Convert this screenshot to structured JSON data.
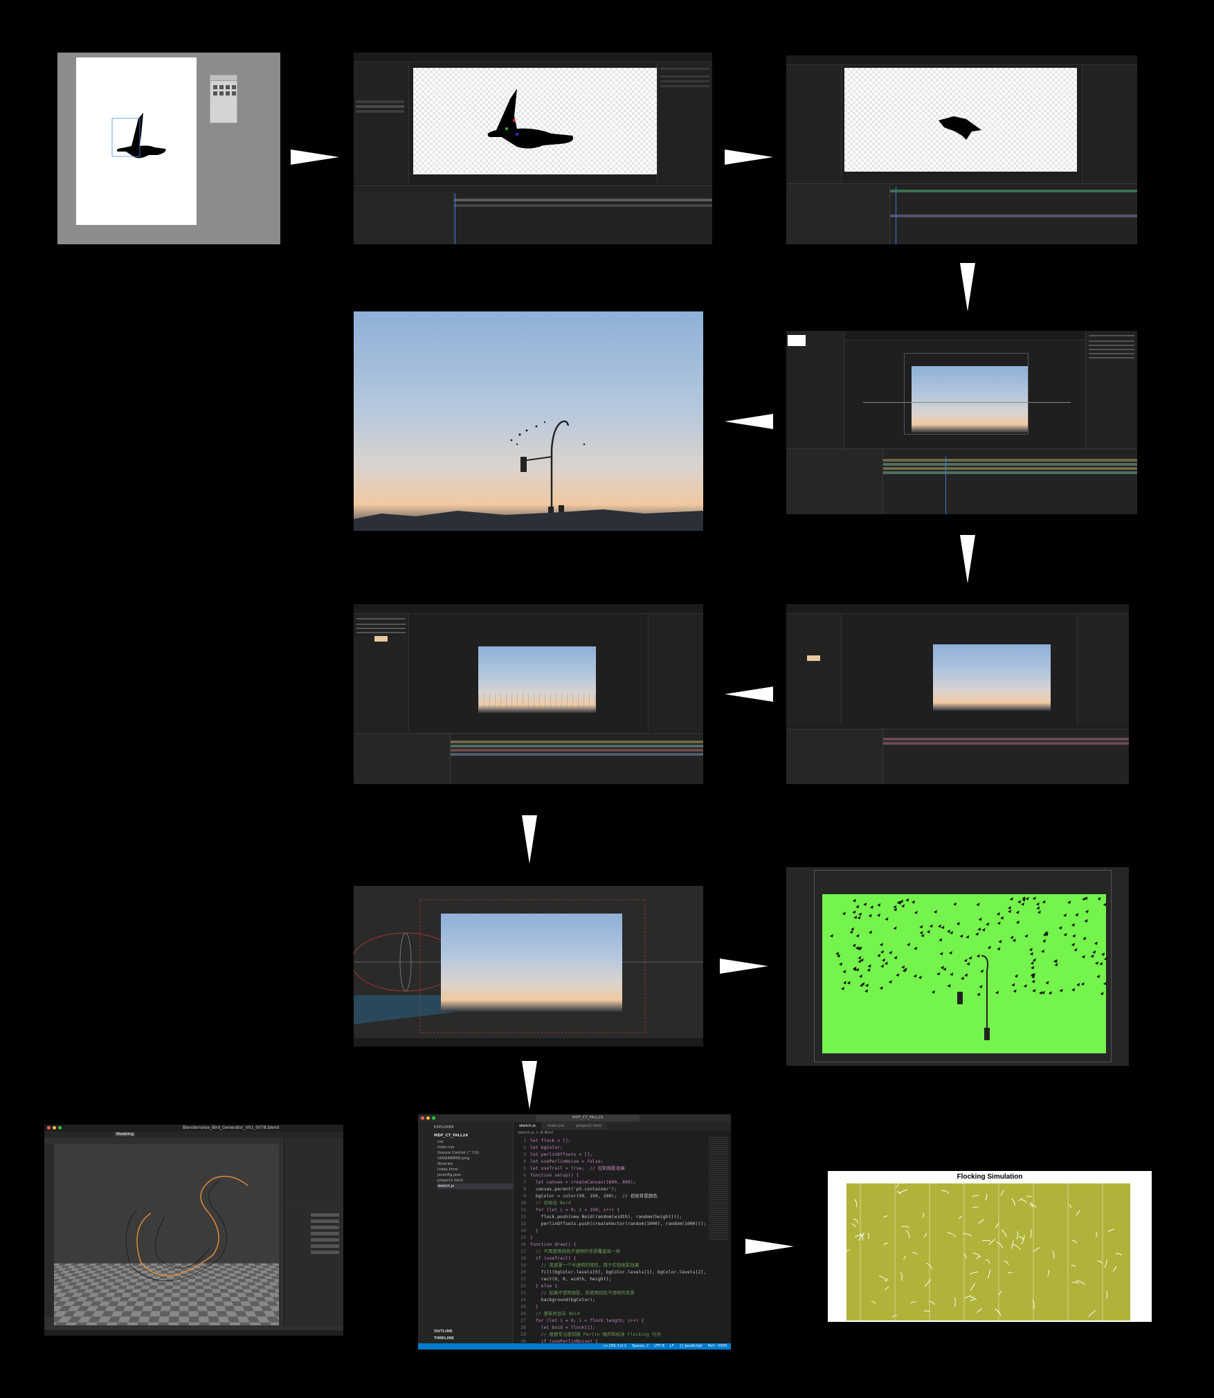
{
  "colors": {
    "background": "#000000",
    "arrow": "#ffffff",
    "green_screen": "#74f44c",
    "flock_bg": "#b0b33a",
    "editor_dark": "#1e1e1e"
  },
  "arrows": [
    {
      "direction": "right"
    },
    {
      "direction": "right"
    },
    {
      "direction": "down"
    },
    {
      "direction": "left"
    },
    {
      "direction": "down"
    },
    {
      "direction": "left"
    },
    {
      "direction": "down"
    },
    {
      "direction": "right"
    },
    {
      "direction": "down"
    },
    {
      "direction": "right"
    }
  ],
  "blender": {
    "file_title": "Blendernoise_Bird_Generator_V01_0078.blend",
    "workspace_tab": "Modeling"
  },
  "vscode": {
    "search_box": "MDF_CT_FALL24",
    "explorer_title": "EXPLORER",
    "workspace": "MDF_CT_FALL24",
    "files": [
      "css",
      "main.css",
      "Source Control (^⇧G)",
      "UIASIANIMSI.png",
      "libraries",
      "index.html",
      "jsconfig.json",
      "project1.html",
      "sketch.js"
    ],
    "tabs": [
      "sketch.js",
      "main.css",
      "project1.html"
    ],
    "breadcrumb": "sketch.js > ⚙ Boid",
    "code_lines": [
      "let flock = [];",
      "let bgColor;",
      "let perlinOffsets = [];",
      "let usePerlinNoise = false;",
      "let useTrail = true;  // 控制拖影效果",
      "",
      "function setup() {",
      "  let canvas = createCanvas(1600, 800);",
      "  canvas.parent('p5-container');",
      "",
      "  bgColor = color(50, 150, 200);  // 初始背景颜色",
      "",
      "  // 初始化 Boid",
      "  for (let i = 0; i < 150; i++) {",
      "    flock.push(new Boid(random(width), random(height)));",
      "    perlinOffsets.push(createVector(random(1000), random(1000)));",
      "  }",
      "}",
      "",
      "function draw() {",
      "  // 不再使用纯色不透明的背景覆盖每一帧",
      "  if (useTrail) {",
      "    // 用遮罩一个半透明的矩形，用于实现拖影效果",
      "    fill(bgColor.levels[0], bgColor.levels[1], bgColor.levels[2], 10);",
      "    rect(0, 0, width, height);",
      "  } else {",
      "    // 如果不使用拖影，则使用纯色不透明的背景",
      "    background(bgColor);",
      "  }",
      "",
      "  // 更新并显示 Boid",
      "  for (let i = 0; i < flock.length; i++) {",
      "    let boid = flock[i];",
      "",
      "    // 根据专注度切换 Perlin 噪声和标准 Flocking 行为",
      "    if (usePerlinNoise) {"
    ],
    "outline_label": "OUTLINE",
    "timeline_label": "TIMELINE",
    "status_bar": [
      "Ln 258, Col 2",
      "Spaces: 2",
      "UTF-8",
      "LF",
      "{} JavaScript",
      "Port : 5500"
    ]
  },
  "flocking": {
    "title": "Flocking Simulation"
  }
}
